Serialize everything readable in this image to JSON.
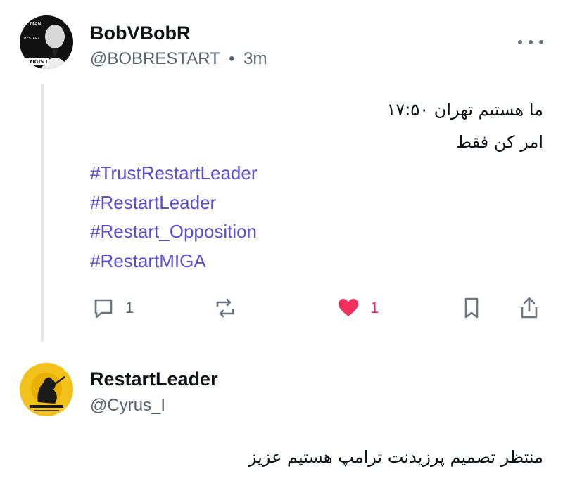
{
  "posts": [
    {
      "author": {
        "display_name": "BobVBobR",
        "handle": "@BOBRESTART",
        "time": "3m",
        "separator": "•"
      },
      "avatar_text": [
        "...MAN",
        "RESTART",
        "CYRUS I"
      ],
      "body_lines": [
        "ما هستیم تهران ۱۷:۵۰",
        "امر کن فقط"
      ],
      "hashtags": [
        "#TrustRestartLeader",
        "#RestartLeader",
        "#Restart_Opposition",
        "#RestartMIGA"
      ],
      "actions": {
        "reply": {
          "icon": "reply-icon",
          "count": "1"
        },
        "repost": {
          "icon": "repost-icon",
          "count": ""
        },
        "like": {
          "icon": "heart-icon",
          "count": "1",
          "liked": true,
          "color": "#f4315e"
        },
        "bookmark": {
          "icon": "bookmark-icon"
        },
        "share": {
          "icon": "share-icon"
        }
      },
      "more_icon": "more-icon"
    },
    {
      "author": {
        "display_name": "RestartLeader",
        "handle": "@Cyrus_I"
      },
      "avatar_colors": {
        "background": "#f2c21b",
        "emblem": "#1a1a1a"
      },
      "body_lines": [
        "منتظر تصمیم پرزیدنت ترامپ هستیم عزیز"
      ]
    }
  ],
  "colors": {
    "hashtag": "#5b4fd9",
    "muted": "#536471",
    "like": "#f4315e",
    "thread": "#e4e7ea"
  }
}
